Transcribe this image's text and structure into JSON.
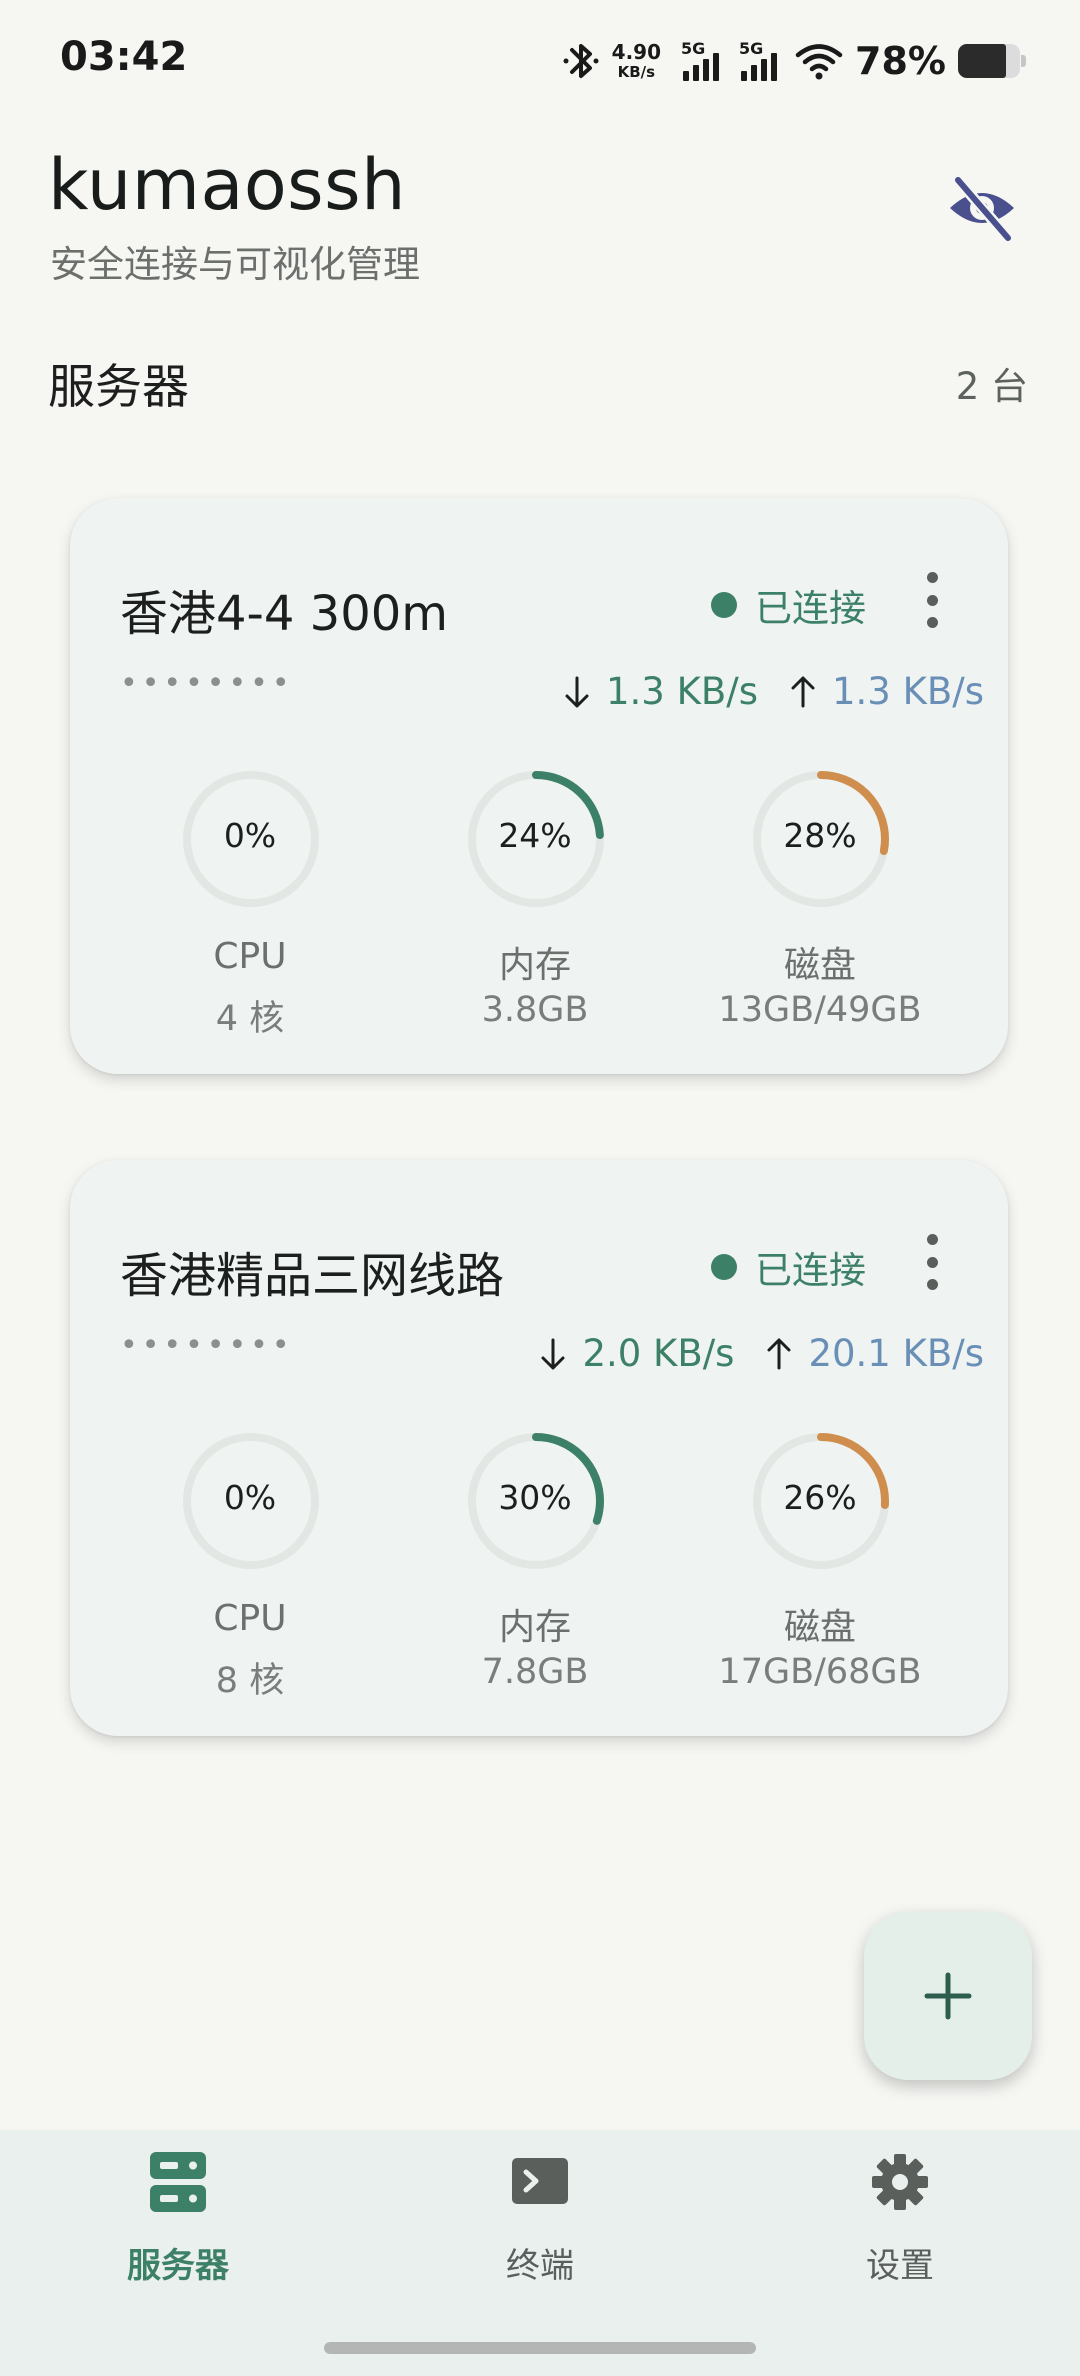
{
  "status_bar": {
    "time": "03:42",
    "net_speed_value": "4.90",
    "net_speed_unit": "KB/s",
    "signal1_label": "5G",
    "signal2_label": "5G",
    "battery_percent": "78%",
    "battery_level": 0.78
  },
  "header": {
    "title": "kumaossh",
    "subtitle": "安全连接与可视化管理",
    "visibility_toggle_icon": "eye-off-icon"
  },
  "section": {
    "title": "服务器",
    "count": "2 台"
  },
  "servers": [
    {
      "name": "香港4-4 300m",
      "status": "已连接",
      "masked_host": "••••••••",
      "download": "1.3 KB/s",
      "upload": "1.3 KB/s",
      "cpu": {
        "percent": "0%",
        "value": 0,
        "label": "CPU",
        "detail": "4 核"
      },
      "memory": {
        "percent": "24%",
        "value": 24,
        "label": "内存",
        "detail": "3.8GB"
      },
      "disk": {
        "percent": "28%",
        "value": 28,
        "label": "磁盘",
        "detail": "13GB/49GB"
      }
    },
    {
      "name": "香港精品三网线路",
      "status": "已连接",
      "masked_host": "••••••••",
      "download": "2.0 KB/s",
      "upload": "20.1 KB/s",
      "cpu": {
        "percent": "0%",
        "value": 0,
        "label": "CPU",
        "detail": "8 核"
      },
      "memory": {
        "percent": "30%",
        "value": 30,
        "label": "内存",
        "detail": "7.8GB"
      },
      "disk": {
        "percent": "26%",
        "value": 26,
        "label": "磁盘",
        "detail": "17GB/68GB"
      }
    }
  ],
  "fab": {
    "icon": "plus-icon"
  },
  "bottom_nav": {
    "items": [
      {
        "label": "服务器",
        "icon": "server-icon",
        "active": true
      },
      {
        "label": "终端",
        "icon": "terminal-icon",
        "active": false
      },
      {
        "label": "设置",
        "icon": "gear-icon",
        "active": false
      }
    ]
  },
  "colors": {
    "accent": "#3d8068",
    "upload": "#6a8fb7",
    "memory_gauge": "#3d8068",
    "disk_gauge": "#d08e4e",
    "gauge_track": "#e3e7e4"
  }
}
